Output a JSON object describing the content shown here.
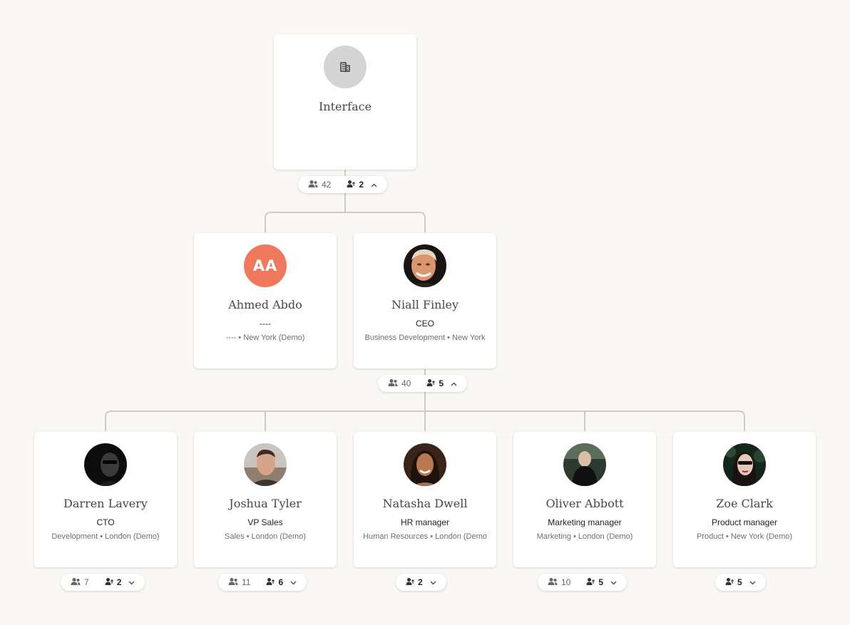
{
  "root": {
    "name": "Interface",
    "avatar_icon": "building-icon",
    "stats": {
      "total": "42",
      "direct": "2",
      "toggle_icon": "chevron-up-icon"
    }
  },
  "level1": [
    {
      "name": "Ahmed Abdo",
      "initials": "AA",
      "title": "----",
      "meta": "---- • New York (Demo)"
    },
    {
      "name": "Niall Finley",
      "title": "CEO",
      "meta": "Business Development • New York",
      "stats": {
        "total": "40",
        "direct": "5",
        "toggle_icon": "chevron-up-icon"
      }
    }
  ],
  "level2": [
    {
      "name": "Darren Lavery",
      "title": "CTO",
      "meta": "Development • London (Demo)",
      "stats": {
        "total": "7",
        "direct": "2",
        "toggle_icon": "chevron-down-icon"
      }
    },
    {
      "name": "Joshua Tyler",
      "title": "VP Sales",
      "meta": "Sales • London (Demo)",
      "stats": {
        "total": "11",
        "direct": "6",
        "toggle_icon": "chevron-down-icon"
      }
    },
    {
      "name": "Natasha Dwell",
      "title": "HR manager",
      "meta": "Human Resources • London (Demo",
      "stats": {
        "direct": "2",
        "toggle_icon": "chevron-down-icon"
      }
    },
    {
      "name": "Oliver Abbott",
      "title": "Marketing manager",
      "meta": "Marketing • London (Demo)",
      "stats": {
        "total": "10",
        "direct": "5",
        "toggle_icon": "chevron-down-icon"
      }
    },
    {
      "name": "Zoe Clark",
      "title": "Product manager",
      "meta": "Product • New York (Demo)",
      "stats": {
        "direct": "5",
        "toggle_icon": "chevron-down-icon"
      }
    }
  ],
  "colors": {
    "background": "#f9f7f3",
    "connector": "#cfcac2",
    "initials_avatar": "#f0795d",
    "org_avatar": "#d4d4d4"
  }
}
